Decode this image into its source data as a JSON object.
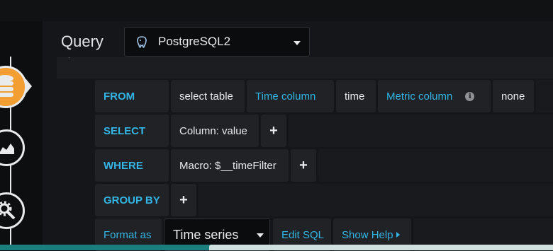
{
  "header": {
    "query_label": "Query",
    "datasource": {
      "name": "PostgreSQL2",
      "icon": "postgresql-elephant-icon"
    }
  },
  "rail": {
    "items": [
      {
        "icon": "database-icon",
        "active": true
      },
      {
        "icon": "area-chart-icon",
        "active": false
      },
      {
        "icon": "gear-wrench-icon",
        "active": false
      }
    ],
    "active_color": "#f29e32"
  },
  "query": {
    "from": {
      "keyword": "FROM",
      "table": "select table",
      "time_column_label": "Time column",
      "time_column_value": "time",
      "metric_column_label": "Metric column",
      "metric_column_value": "none"
    },
    "select": {
      "keyword": "SELECT",
      "column": "Column: value"
    },
    "where": {
      "keyword": "WHERE",
      "macro": "Macro: $__timeFilter"
    },
    "group_by": {
      "keyword": "GROUP BY"
    },
    "format": {
      "label": "Format as",
      "selected": "Time series",
      "edit_sql": "Edit SQL",
      "show_help": "Show Help"
    },
    "plus_symbol": "+"
  },
  "colors": {
    "keyword": "#33b5e5",
    "segment_bg": "#202226",
    "panel_bg": "#141619"
  }
}
